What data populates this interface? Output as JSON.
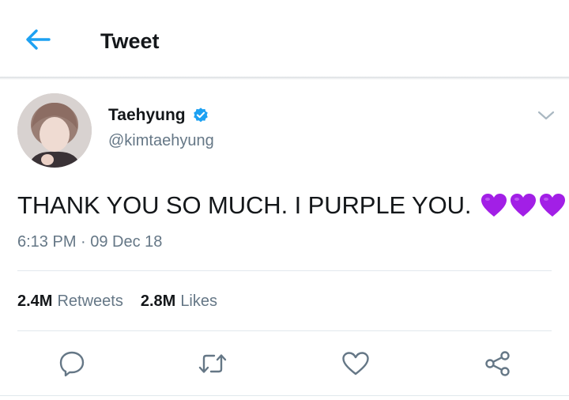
{
  "header": {
    "title": "Tweet",
    "back_icon": "arrow-left-icon",
    "accent_color": "#1da1f2"
  },
  "tweet": {
    "author": {
      "display_name": "Taehyung",
      "handle": "@kimtaehyung",
      "verified": true,
      "verified_icon": "verified-badge-icon"
    },
    "text": "THANK YOU SO MUCH. I PURPLE YOU.",
    "emoji": [
      "purple-heart",
      "purple-heart",
      "purple-heart"
    ],
    "emoji_color": "#a21fe6",
    "timestamp": "6:13 PM · 09 Dec 18",
    "more_icon": "chevron-down-icon"
  },
  "stats": {
    "retweets_count": "2.4M",
    "retweets_label": "Retweets",
    "likes_count": "2.8M",
    "likes_label": "Likes"
  },
  "actions": [
    {
      "name": "reply",
      "icon": "reply-icon"
    },
    {
      "name": "retweet",
      "icon": "retweet-icon"
    },
    {
      "name": "like",
      "icon": "heart-icon"
    },
    {
      "name": "share",
      "icon": "share-icon"
    }
  ],
  "colors": {
    "text_primary": "#14171a",
    "text_secondary": "#657786",
    "divider": "#e1e8ed"
  }
}
